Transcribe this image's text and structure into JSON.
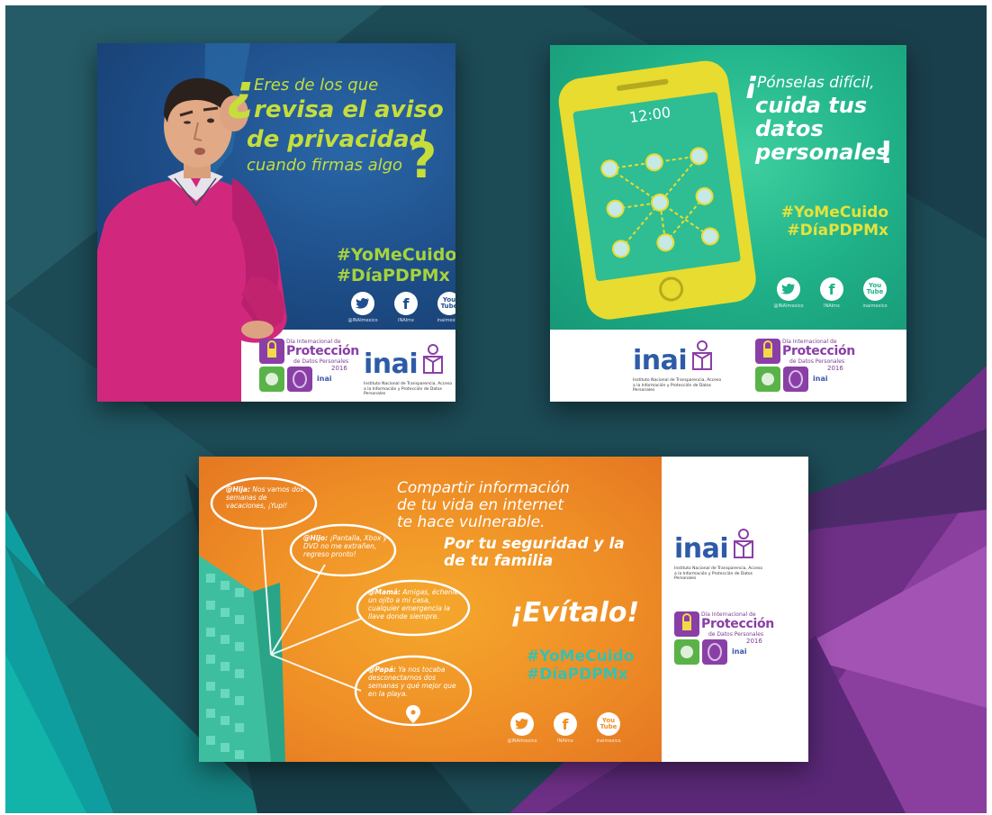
{
  "card1": {
    "question": {
      "open": "¿",
      "line1": "Eres de los que",
      "line2": "revisa el aviso",
      "line3": "de privacidad",
      "line4": "cuando firmas algo",
      "close": "?"
    },
    "hashtags": [
      "#YoMeCuido",
      "#DíaPDPMx"
    ],
    "social": [
      {
        "icon": "twitter-icon",
        "label": "@INAImexico"
      },
      {
        "icon": "facebook-icon",
        "label": "INAImx"
      },
      {
        "icon": "youtube-icon",
        "label": "inaimexico"
      }
    ]
  },
  "card2": {
    "headline": {
      "open": "¡",
      "line1": "Pónselas difícil,",
      "line2": "cuida tus",
      "line3": "datos",
      "line4": "personales",
      "close": "!"
    },
    "phone_time": "12:00",
    "hashtags": [
      "#YoMeCuido",
      "#DíaPDPMx"
    ],
    "social": [
      {
        "icon": "twitter-icon",
        "label": "@INAImexico"
      },
      {
        "icon": "facebook-icon",
        "label": "INAImx"
      },
      {
        "icon": "youtube-icon",
        "label": "inaimexico"
      }
    ]
  },
  "card3": {
    "bubbles": [
      {
        "handle": "@Hija:",
        "text": "Nos vamos dos semanas de vacaciones, ¡Yupi!"
      },
      {
        "handle": "@Hijo:",
        "text": "¡Pantalla, Xbox y DVD no me extrañen, regreso pronto!"
      },
      {
        "handle": "@Mamá:",
        "text": "Amigas, échenle un ojito a mi casa, cualquier emergencia la llave donde siempre."
      },
      {
        "handle": "@Papá:",
        "text": "Ya nos tocaba desconectarnos dos semanas y qué mejor que en la playa."
      }
    ],
    "message": {
      "line1": "Compartir información",
      "line2": "de tu vida en internet",
      "line3": "te hace vulnerable.",
      "line4": "Por tu seguridad y la",
      "line5": "de tu familia"
    },
    "evitalo": "¡Evítalo!",
    "hashtags": [
      "#YoMeCuido",
      "#DíaPDPMx"
    ],
    "social": [
      {
        "icon": "twitter-icon",
        "label": "@INAImexico"
      },
      {
        "icon": "facebook-icon",
        "label": "INAImx"
      },
      {
        "icon": "youtube-icon",
        "label": "inaimexico"
      }
    ]
  },
  "inai_logo": {
    "word": "inai",
    "subtitle": "Instituto Nacional de Transparencia, Acceso a la Información y Protección de Datos Personales"
  },
  "dia_logo": {
    "line1": "Día Internacional de",
    "line2": "Protección",
    "line3": "de Datos Personales",
    "year": "2016",
    "mini": "inai"
  },
  "colors": {
    "card1_bg": "#1f4f8e",
    "card1_accent": "#c6dd3b",
    "card2_bg": "#20b289",
    "card2_accent": "#e5e23c",
    "card3_bg": "#ef8f26",
    "card3_accent": "#35c1b0",
    "inai_blue": "#2d5ba8",
    "dia_purple": "#8a3fa6"
  }
}
